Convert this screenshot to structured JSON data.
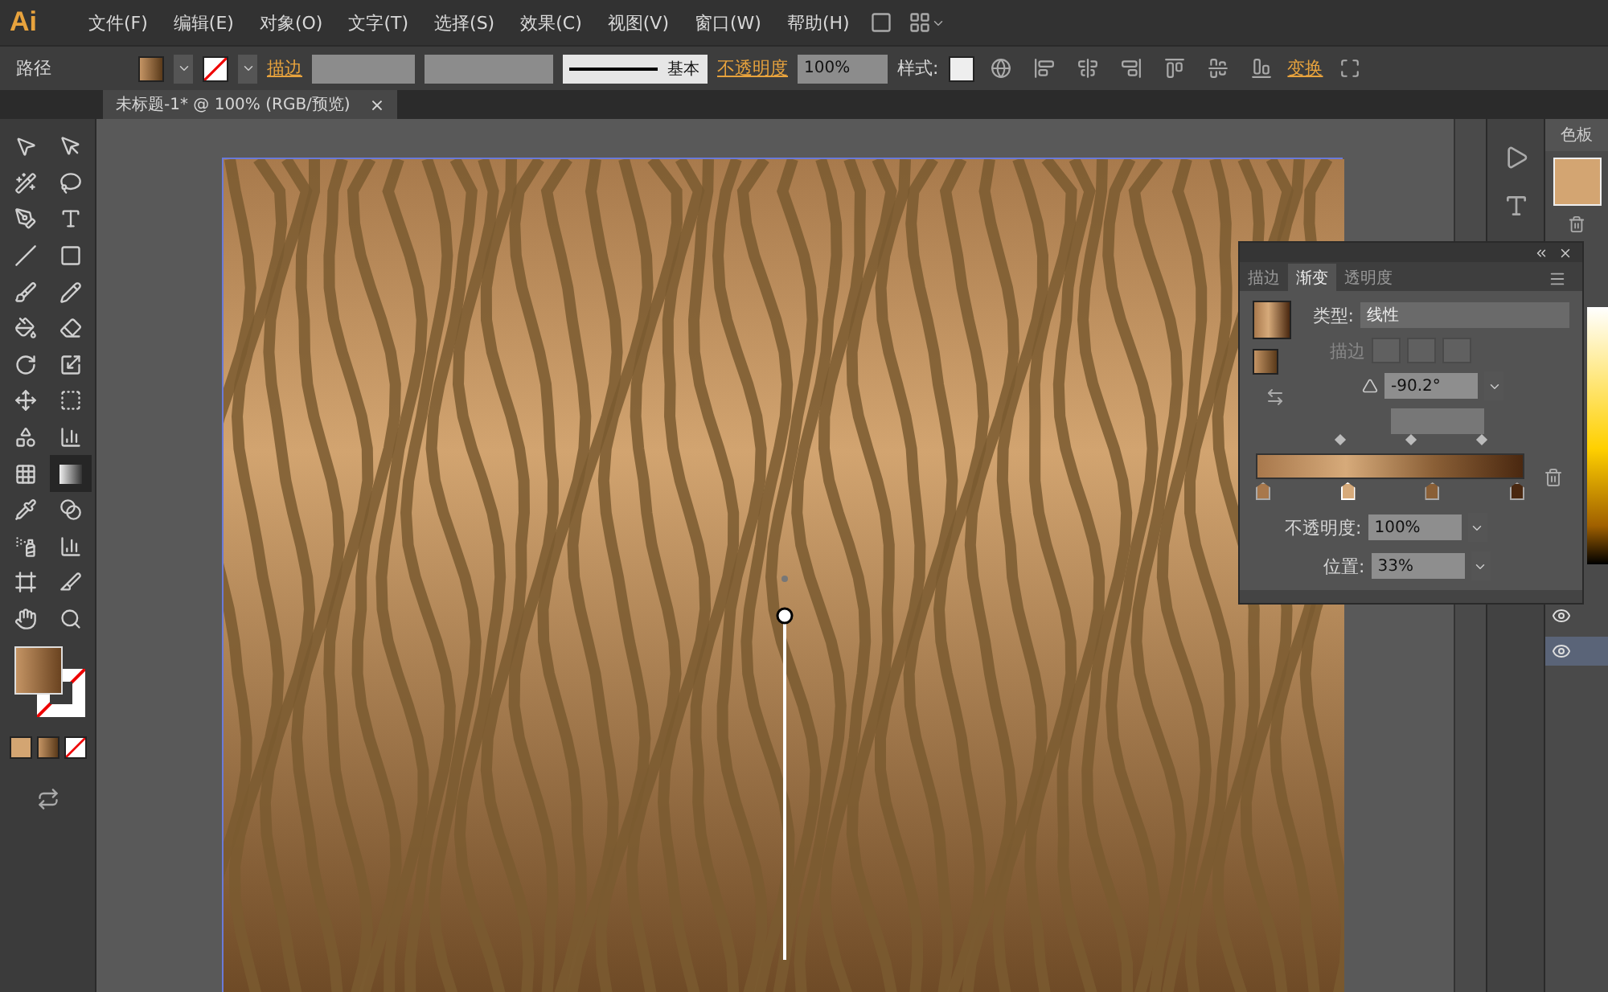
{
  "app": {
    "logo": "Ai"
  },
  "menu": [
    "文件(F)",
    "编辑(E)",
    "对象(O)",
    "文字(T)",
    "选择(S)",
    "效果(C)",
    "视图(V)",
    "窗口(W)",
    "帮助(H)"
  ],
  "control_bar": {
    "object_type": "路径",
    "stroke_label": "描边",
    "stroke_profile": "基本",
    "opacity_label": "不透明度",
    "opacity": "100%",
    "style_label": "样式:",
    "transform_label": "变换"
  },
  "document_tab": {
    "title": "未标题-1* @ 100% (RGB/预览)",
    "close": "×"
  },
  "tools": [
    {
      "kind": "select",
      "selected": false
    },
    {
      "kind": "direct",
      "selected": false
    },
    {
      "kind": "wand",
      "selected": false
    },
    {
      "kind": "lasso",
      "selected": false
    },
    {
      "kind": "pen",
      "selected": false
    },
    {
      "kind": "type",
      "selected": false
    },
    {
      "kind": "line",
      "selected": false
    },
    {
      "kind": "rect",
      "selected": false
    },
    {
      "kind": "brush",
      "selected": false
    },
    {
      "kind": "pencil",
      "selected": false
    },
    {
      "kind": "blob",
      "selected": false
    },
    {
      "kind": "eraser",
      "selected": false
    },
    {
      "kind": "rotate",
      "selected": false
    },
    {
      "kind": "scale",
      "selected": false
    },
    {
      "kind": "warp",
      "selected": false
    },
    {
      "kind": "transform",
      "selected": false
    },
    {
      "kind": "builder",
      "selected": false
    },
    {
      "kind": "perspective",
      "selected": false
    },
    {
      "kind": "mesh",
      "selected": false
    },
    {
      "kind": "gradient",
      "selected": true
    },
    {
      "kind": "eyedropper",
      "selected": false
    },
    {
      "kind": "blend",
      "selected": false
    },
    {
      "kind": "spray",
      "selected": false
    },
    {
      "kind": "graph",
      "selected": false
    },
    {
      "kind": "artboard",
      "selected": false
    },
    {
      "kind": "slice",
      "selected": false
    },
    {
      "kind": "hand",
      "selected": false
    },
    {
      "kind": "zoom",
      "selected": false
    }
  ],
  "gradient_panel": {
    "tabs": [
      {
        "label": "描边",
        "selected": false
      },
      {
        "label": "渐变",
        "selected": true
      },
      {
        "label": "透明度",
        "selected": false
      }
    ],
    "type_label": "类型:",
    "type": "线性",
    "stroke_label": "描边",
    "stroke_disabled": true,
    "angle": "-90.2°",
    "opacity_label": "不透明度:",
    "opacity": "100%",
    "location_label": "位置:",
    "location": "33%",
    "stops": [
      {
        "color": "#a8784c",
        "selected": false
      },
      {
        "color": "#d6aa7a",
        "selected": true
      },
      {
        "color": "#8a5f36",
        "selected": false
      },
      {
        "color": "#4a2810",
        "selected": false
      }
    ]
  },
  "swatches_panel": {
    "tab": "色板"
  }
}
